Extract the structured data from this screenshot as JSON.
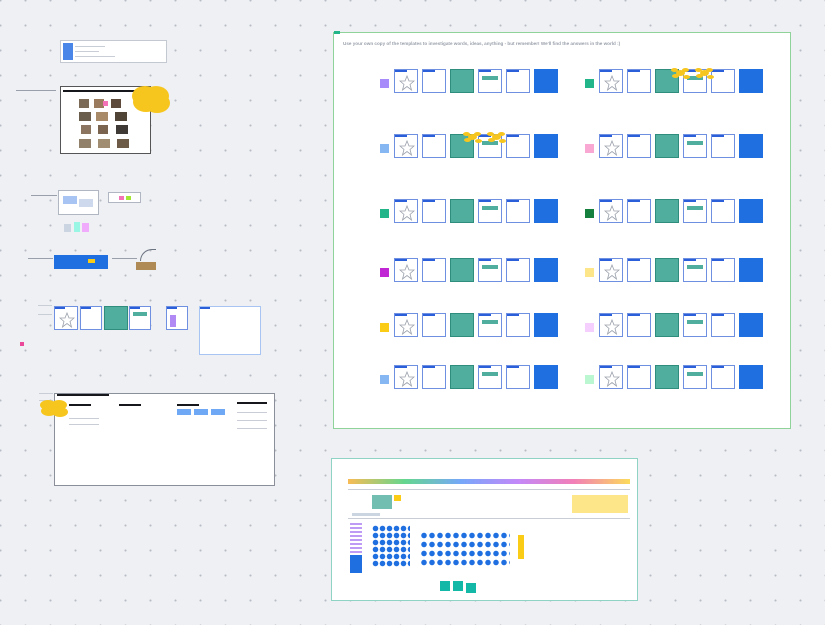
{
  "board": {
    "background_color": "#eef0f3",
    "main_frame": {
      "instruction": "Use your own copy of the templates to investigate words, ideas, anything - but remember! We'll find the answers in the world :)"
    },
    "colors": {
      "accent_blue": "#1f6fe0",
      "teal": "#4fae9e",
      "sticky_yellow": "#f7c61e",
      "frame_border_green": "#8fd39b"
    },
    "row_markers": [
      {
        "color": "#a78bfa"
      },
      {
        "color": "#87b7f3"
      },
      {
        "color": "#22b58a"
      },
      {
        "color": "#c026d3"
      },
      {
        "color": "#facc15"
      },
      {
        "color": "#87b7f3"
      }
    ],
    "right_markers": [
      {
        "color": "#22b58a"
      },
      {
        "color": "#f9a8d4"
      },
      {
        "color": "#15803d"
      },
      {
        "color": "#fde68a"
      },
      {
        "color": "#f5d0fe"
      },
      {
        "color": "#bbf7d0"
      }
    ]
  }
}
